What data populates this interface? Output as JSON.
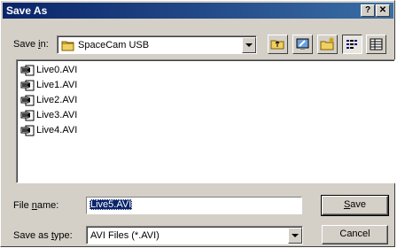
{
  "window": {
    "title": "Save As",
    "help_glyph": "?",
    "close_glyph": "✕"
  },
  "save_in": {
    "label_prefix": "Save ",
    "label_accel": "i",
    "label_suffix": "n:",
    "value": "SpaceCam USB"
  },
  "files": [
    "Live0.AVI",
    "Live1.AVI",
    "Live2.AVI",
    "Live3.AVI",
    "Live4.AVI"
  ],
  "file_name": {
    "label_prefix": "File ",
    "label_accel": "n",
    "label_suffix": "ame:",
    "value": "Live5.AVI"
  },
  "save_as_type": {
    "label_prefix": "Save as ",
    "label_accel": "t",
    "label_suffix": "ype:",
    "value": "AVI Files (*.AVI)"
  },
  "buttons": {
    "save_accel": "S",
    "save_rest": "ave",
    "cancel": "Cancel"
  },
  "colors": {
    "titlebar_start": "#0a246a",
    "titlebar_end": "#3a6ea5",
    "face": "#d4d0c8",
    "selection": "#0a246a"
  }
}
